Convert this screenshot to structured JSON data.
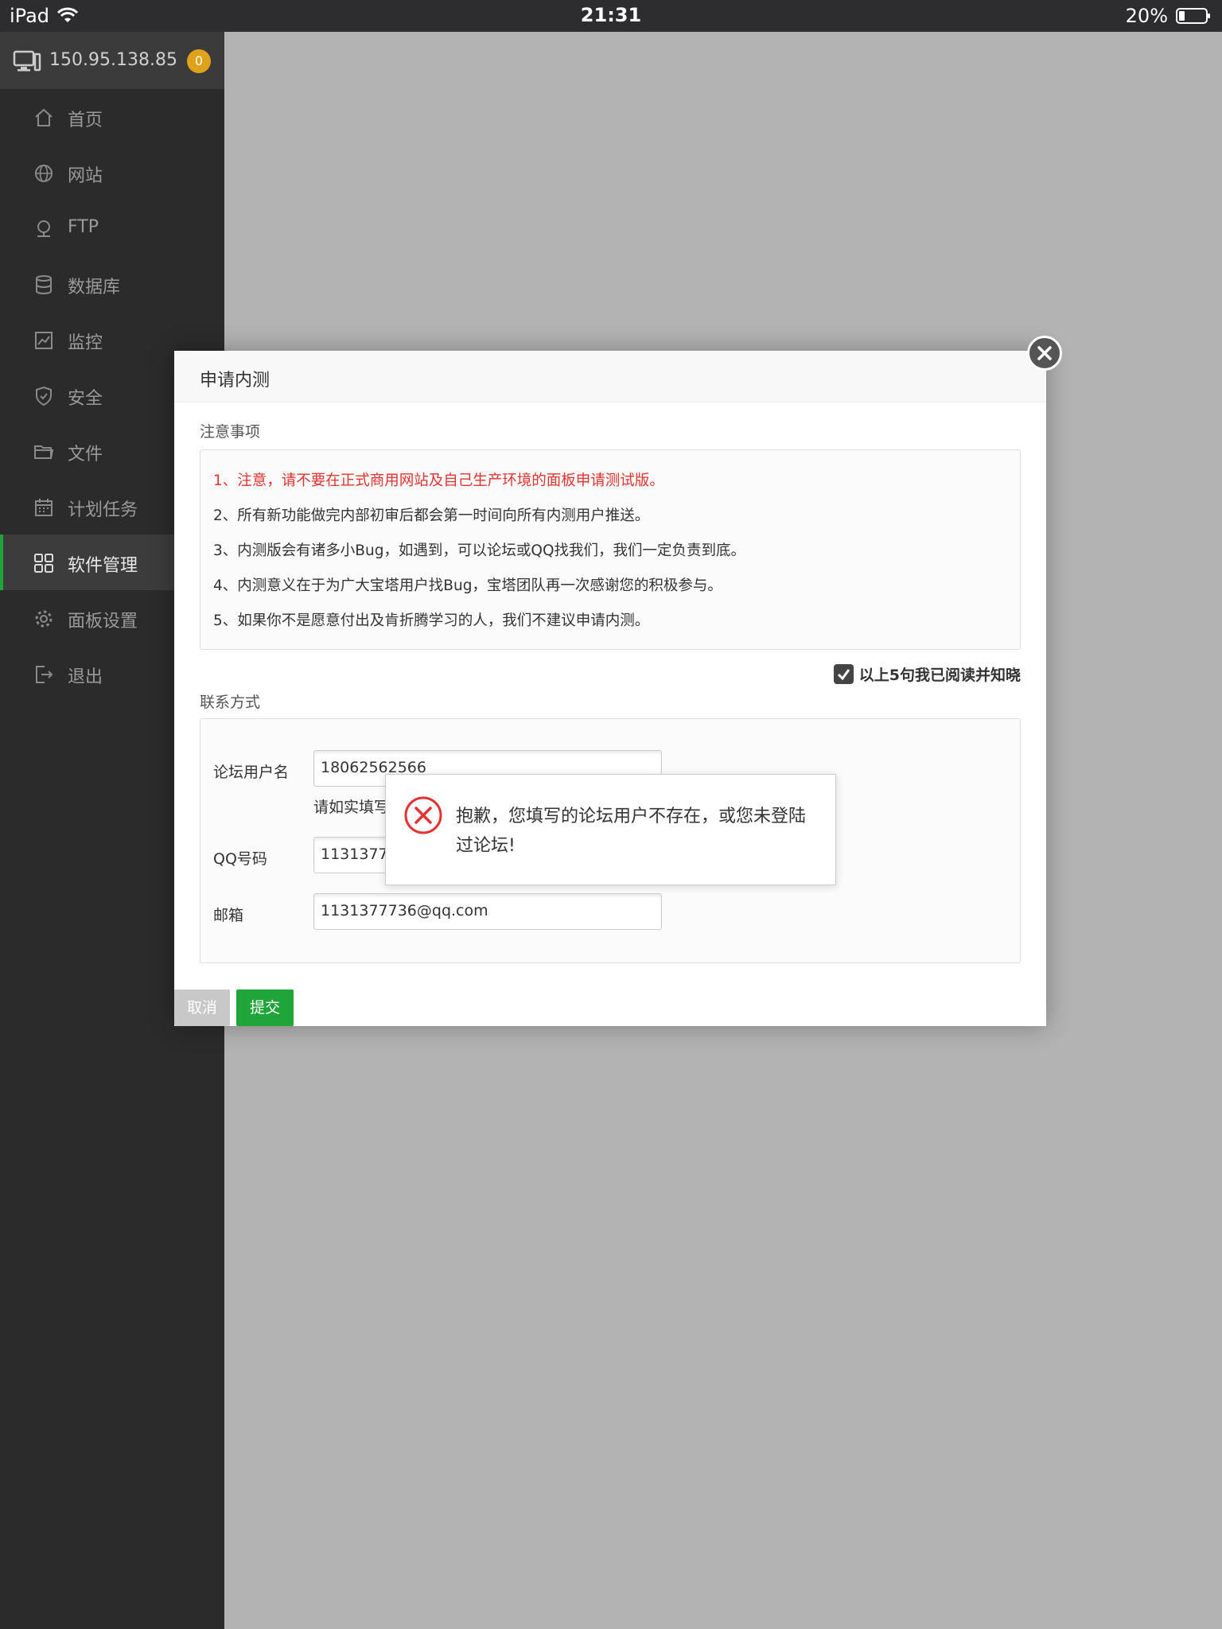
{
  "status_bar": {
    "device": "iPad",
    "time": "21:31",
    "battery": "20%"
  },
  "sidebar": {
    "server_ip": "150.95.138.85",
    "badge_count": "0",
    "items": [
      {
        "label": "首页",
        "icon": "home-icon"
      },
      {
        "label": "网站",
        "icon": "globe-icon"
      },
      {
        "label": "FTP",
        "icon": "ftp-icon"
      },
      {
        "label": "数据库",
        "icon": "database-icon"
      },
      {
        "label": "监控",
        "icon": "monitor-chart-icon"
      },
      {
        "label": "安全",
        "icon": "shield-icon"
      },
      {
        "label": "文件",
        "icon": "folder-icon"
      },
      {
        "label": "计划任务",
        "icon": "calendar-icon"
      },
      {
        "label": "软件管理",
        "icon": "grid-icon",
        "active": true
      },
      {
        "label": "面板设置",
        "icon": "gear-icon"
      },
      {
        "label": "退出",
        "icon": "logout-icon"
      }
    ]
  },
  "modal": {
    "title": "申请内测",
    "notice_title": "注意事项",
    "notices": [
      "1、注意，请不要在正式商用网站及自己生产环境的面板申请测试版。",
      "2、所有新功能做完内部初审后都会第一时间向所有内测用户推送。",
      "3、内测版会有诸多小Bug，如遇到，可以论坛或QQ找我们，我们一定负责到底。",
      "4、内测意义在于为广大宝塔用户找Bug，宝塔团队再一次感谢您的积极参与。",
      "5、如果你不是愿意付出及肯折腾学习的人，我们不建议申请内测。"
    ],
    "agree_label": "以上5句我已阅读并知晓",
    "contact_title": "联系方式",
    "fields": {
      "forum_label": "论坛用户名",
      "forum_value": "18062562566",
      "forum_hint": "请如实填写",
      "qq_label": "QQ号码",
      "qq_value": "113137773",
      "email_label": "邮箱",
      "email_value": "1131377736@qq.com"
    },
    "cancel_label": "取消",
    "submit_label": "提交"
  },
  "toast": {
    "message": "抱歉，您填写的论坛用户不存在，或您未登陆过论坛!"
  },
  "colors": {
    "accent_green": "#20a53a",
    "error_red": "#e8302e",
    "badge_orange": "#e0a11b"
  }
}
